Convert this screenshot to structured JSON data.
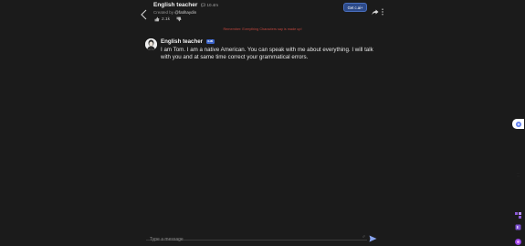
{
  "header": {
    "bot_name": "English teacher",
    "chat_count": "10.4m",
    "creator_prefix": "Created by",
    "creator_handle": "@fatihaydin",
    "likes": "2.1k",
    "get_cai_label": "Get c.ai+"
  },
  "disclaimer": "Remember: Everything Characters say is made up!",
  "messages": [
    {
      "author": "English teacher",
      "badge": "c.ai",
      "text": "I am Tom. I am a native American. You can speak with me about everything. I will talk with you and at same time correct your grammatical errors."
    }
  ],
  "composer": {
    "placeholder": "Type a message",
    "value": ""
  },
  "colors": {
    "background": "#1b1b1b",
    "accent": "#3a63c9",
    "disclaimer": "#c2463e"
  },
  "icons": [
    "back-arrow-icon",
    "chat-bubble-icon",
    "thumbs-up-icon",
    "thumbs-down-icon",
    "share-icon",
    "more-vertical-icon",
    "send-icon"
  ]
}
